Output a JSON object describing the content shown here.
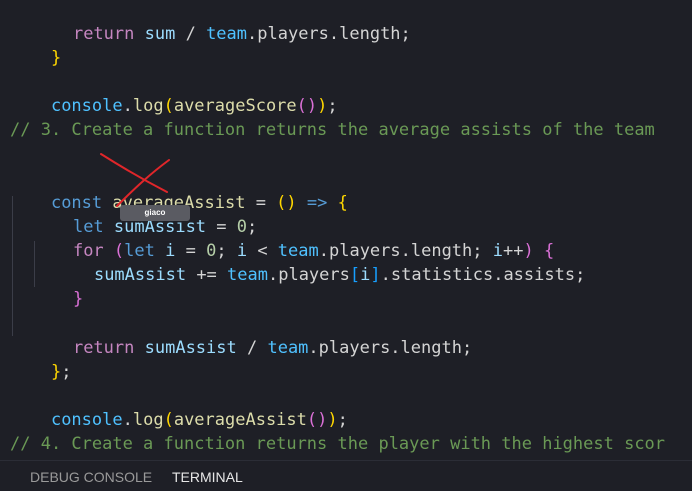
{
  "editor": {
    "line1": {
      "kw": "return",
      "sum": "sum",
      "op": " / ",
      "team": "team",
      "rest": ".players.length;"
    },
    "line2": {
      "brace": "}"
    },
    "line3": {
      "obj": "console",
      "dot": ".",
      "fn": "log",
      "p1": "(",
      "call": "averageScore",
      "p2": "()",
      "p3": ")",
      "semi": ";"
    },
    "comment3": "// 3. Create a function returns the average assists of the team",
    "line_const": {
      "kw": "const",
      "name": "averageAssist",
      "op": " = ",
      "paren": "()",
      "arrow": " => ",
      "brace": "{"
    },
    "line_let": {
      "kw": "let",
      "name": "sumAssist",
      "op": " = ",
      "num": "0",
      "semi": ";"
    },
    "line_for": {
      "kw": "for",
      "p": " (",
      "kw2": "let",
      "i": "i",
      "op1": " = ",
      "zero": "0",
      "semi1": "; ",
      "i2": "i",
      "lt": " < ",
      "team": "team",
      "rest": ".players.length; ",
      "i3": "i",
      "inc": "++",
      "pclose": ")",
      "brace": " {"
    },
    "line_sum": {
      "name": "sumAssist",
      "op": " += ",
      "team": "team",
      "dot1": ".players",
      "b1": "[",
      "i": "i",
      "b2": "]",
      "rest": ".statistics.assists;"
    },
    "line_forclose": {
      "brace": "}"
    },
    "line_return": {
      "kw": "return",
      "name": "sumAssist",
      "op": " / ",
      "team": "team",
      "rest": ".players.length;"
    },
    "line_close": {
      "brace": "}",
      "semi": ";"
    },
    "line_log": {
      "obj": "console",
      "dot": ".",
      "fn": "log",
      "p1": "(",
      "call": "averageAssist",
      "p2": "()",
      "p3": ")",
      "semi": ";"
    },
    "comment4": "// 4. Create a function returns the player with the highest scor"
  },
  "tooltip": {
    "label": "giaco"
  },
  "panel": {
    "tabs": [
      {
        "label": "DEBUG CONSOLE",
        "active": false
      },
      {
        "label": "TERMINAL",
        "active": true
      }
    ]
  },
  "colors": {
    "background": "#1e1f26",
    "keyword": "#569cd6",
    "control": "#c586c0",
    "function": "#dcdcaa",
    "variable": "#9cdcfe",
    "comment": "#6a9955",
    "number": "#b5cea8",
    "annotation": "#e0262a"
  }
}
